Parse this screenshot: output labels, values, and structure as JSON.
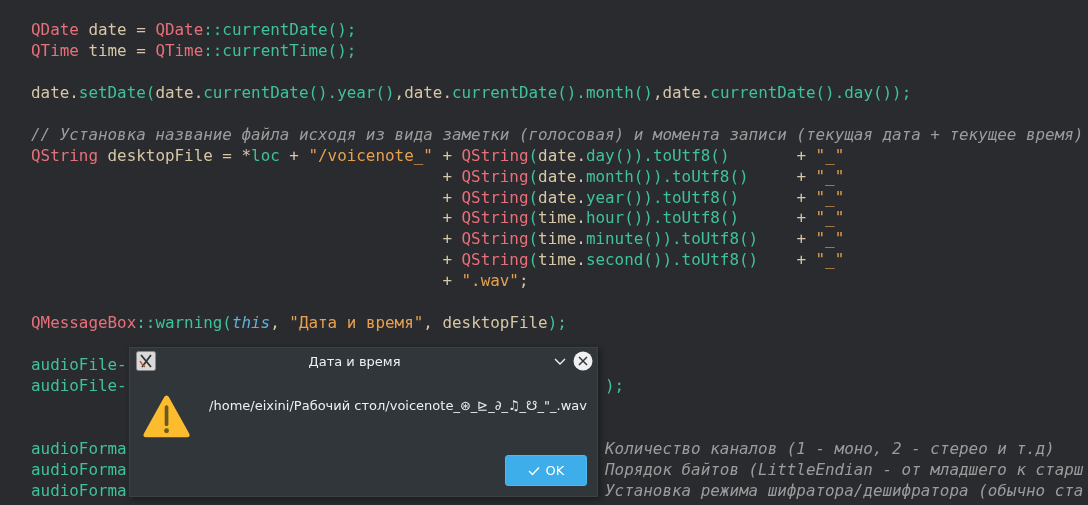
{
  "editor": {
    "lines": [
      {
        "kind": "code",
        "tokens": [
          {
            "kind": "type",
            "text": "QDate"
          },
          {
            "kind": "plain",
            "text": " date = "
          },
          {
            "kind": "type",
            "text": "QDate"
          },
          {
            "kind": "call",
            "text": "::currentDate();"
          }
        ]
      },
      {
        "kind": "code",
        "tokens": [
          {
            "kind": "type",
            "text": "QTime"
          },
          {
            "kind": "plain",
            "text": " time = "
          },
          {
            "kind": "type",
            "text": "QTime"
          },
          {
            "kind": "call",
            "text": "::currentTime();"
          }
        ]
      },
      {
        "kind": "blank"
      },
      {
        "kind": "code",
        "tokens": [
          {
            "kind": "plain",
            "text": "date."
          },
          {
            "kind": "call",
            "text": "setDate("
          },
          {
            "kind": "plain",
            "text": "date."
          },
          {
            "kind": "call",
            "text": "currentDate().year()"
          },
          {
            "kind": "plain",
            "text": ",date."
          },
          {
            "kind": "call",
            "text": "currentDate().month()"
          },
          {
            "kind": "plain",
            "text": ",date."
          },
          {
            "kind": "call",
            "text": "currentDate().day());"
          }
        ]
      },
      {
        "kind": "blank"
      },
      {
        "kind": "code",
        "tokens": [
          {
            "kind": "comment",
            "text": "// Установка название файла исходя из вида заметки (голосовая) и момента записи (текущая дата + текущее время)"
          }
        ]
      },
      {
        "kind": "code",
        "tokens": [
          {
            "kind": "type",
            "text": "QString"
          },
          {
            "kind": "plain",
            "text": " desktopFile = *"
          },
          {
            "kind": "call",
            "text": "loc"
          },
          {
            "kind": "plain",
            "text": " + "
          },
          {
            "kind": "string",
            "text": "\"/voicenote_\""
          },
          {
            "kind": "plain",
            "text": " + "
          },
          {
            "kind": "type",
            "text": "QString"
          },
          {
            "kind": "call",
            "text": "("
          },
          {
            "kind": "plain",
            "text": "date."
          },
          {
            "kind": "call",
            "text": "day()).toUtf8()"
          },
          {
            "kind": "plain",
            "text": "       + "
          },
          {
            "kind": "string",
            "text": "\"_\""
          }
        ]
      },
      {
        "kind": "continuation",
        "tokens": [
          {
            "kind": "plain",
            "text": "+ "
          },
          {
            "kind": "type",
            "text": "QString"
          },
          {
            "kind": "call",
            "text": "("
          },
          {
            "kind": "plain",
            "text": "date."
          },
          {
            "kind": "call",
            "text": "month()).toUtf8()"
          },
          {
            "kind": "plain",
            "text": "     + "
          },
          {
            "kind": "string",
            "text": "\"_\""
          }
        ]
      },
      {
        "kind": "continuation",
        "tokens": [
          {
            "kind": "plain",
            "text": "+ "
          },
          {
            "kind": "type",
            "text": "QString"
          },
          {
            "kind": "call",
            "text": "("
          },
          {
            "kind": "plain",
            "text": "date."
          },
          {
            "kind": "call",
            "text": "year()).toUtf8()"
          },
          {
            "kind": "plain",
            "text": "      + "
          },
          {
            "kind": "string",
            "text": "\"_\""
          }
        ]
      },
      {
        "kind": "continuation",
        "tokens": [
          {
            "kind": "plain",
            "text": "+ "
          },
          {
            "kind": "type",
            "text": "QString"
          },
          {
            "kind": "call",
            "text": "("
          },
          {
            "kind": "plain",
            "text": "time."
          },
          {
            "kind": "call",
            "text": "hour()).toUtf8()"
          },
          {
            "kind": "plain",
            "text": "      + "
          },
          {
            "kind": "string",
            "text": "\"_\""
          }
        ]
      },
      {
        "kind": "continuation",
        "tokens": [
          {
            "kind": "plain",
            "text": "+ "
          },
          {
            "kind": "type",
            "text": "QString"
          },
          {
            "kind": "call",
            "text": "("
          },
          {
            "kind": "plain",
            "text": "time."
          },
          {
            "kind": "call",
            "text": "minute()).toUtf8()"
          },
          {
            "kind": "plain",
            "text": "    + "
          },
          {
            "kind": "string",
            "text": "\"_\""
          }
        ]
      },
      {
        "kind": "continuation",
        "tokens": [
          {
            "kind": "plain",
            "text": "+ "
          },
          {
            "kind": "type",
            "text": "QString"
          },
          {
            "kind": "call",
            "text": "("
          },
          {
            "kind": "plain",
            "text": "time."
          },
          {
            "kind": "call",
            "text": "second()).toUtf8()"
          },
          {
            "kind": "plain",
            "text": "    + "
          },
          {
            "kind": "string",
            "text": "\"_\""
          }
        ]
      },
      {
        "kind": "continuation",
        "tokens": [
          {
            "kind": "plain",
            "text": "+ "
          },
          {
            "kind": "string",
            "text": "\".wav\""
          },
          {
            "kind": "plain",
            "text": ";"
          }
        ]
      },
      {
        "kind": "blank"
      },
      {
        "kind": "code",
        "tokens": [
          {
            "kind": "type",
            "text": "QMessageBox"
          },
          {
            "kind": "call",
            "text": "::warning("
          },
          {
            "kind": "keyword",
            "text": "this"
          },
          {
            "kind": "plain",
            "text": ", "
          },
          {
            "kind": "string",
            "text": "\"Дата и время\""
          },
          {
            "kind": "plain",
            "text": ", desktopFile"
          },
          {
            "kind": "call",
            "text": ");"
          }
        ]
      },
      {
        "kind": "blank"
      },
      {
        "kind": "code",
        "tokens": [
          {
            "kind": "call",
            "text": "audioFile-"
          }
        ]
      },
      {
        "kind": "code",
        "tokens": [
          {
            "kind": "call",
            "text": "audioFile-"
          }
        ],
        "tail": [
          {
            "kind": "call",
            "text": ");"
          }
        ]
      },
      {
        "kind": "blank"
      },
      {
        "kind": "blank"
      },
      {
        "kind": "code",
        "tokens": [
          {
            "kind": "call",
            "text": "audioForma"
          }
        ],
        "tail": [
          {
            "kind": "comment",
            "text": "Количество каналов (1 - моно, 2 - стерео и т.д)"
          }
        ]
      },
      {
        "kind": "code",
        "tokens": [
          {
            "kind": "call",
            "text": "audioForma"
          }
        ],
        "tail": [
          {
            "kind": "comment",
            "text": "Порядок байтов (LittleEndian - от младшего к старш"
          }
        ]
      },
      {
        "kind": "code",
        "tokens": [
          {
            "kind": "call",
            "text": "audioForma"
          }
        ],
        "tail": [
          {
            "kind": "comment",
            "text": "Установка режима шифратора/дешифратора (обычно ста"
          }
        ]
      }
    ]
  },
  "dialog": {
    "title": "Дата и время",
    "message": "/home/eixini/Рабочий стол/voicenote_⊛_⊵_∂_♫_☋_\"_.wav",
    "buttons": [
      {
        "label": "OK",
        "kind": "accept"
      }
    ]
  }
}
